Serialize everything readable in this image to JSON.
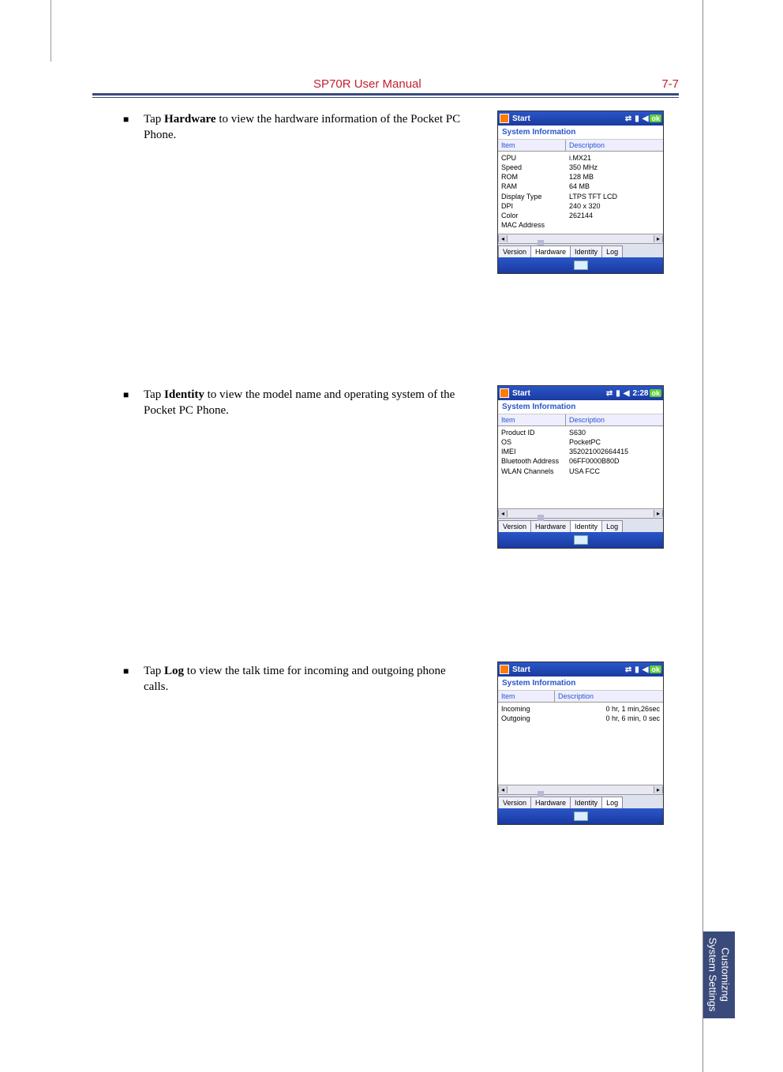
{
  "header": {
    "title": "SP70R User Manual",
    "page": "7-7"
  },
  "bullets": {
    "b1_pre": "Tap ",
    "b1_bold": "Hardware",
    "b1_post": " to view the hardware information of the Pocket PC Phone.",
    "b2_pre": "Tap ",
    "b2_bold": "Identity",
    "b2_post": " to view the model name and operating system of the Pocket PC Phone.",
    "b3_pre": "Tap ",
    "b3_bold": "Log",
    "b3_post": " to view the talk time for incoming and outgoing phone calls."
  },
  "wm_common": {
    "start": "Start",
    "ok": "ok",
    "subtitle": "System Information",
    "col_item": "Item",
    "col_desc": "Description",
    "tab_version": "Version",
    "tab_hardware": "Hardware",
    "tab_identity": "Identity",
    "tab_log": "Log"
  },
  "shot1": {
    "time": "",
    "items": [
      "CPU",
      "Speed",
      "ROM",
      "RAM",
      "Display Type",
      "DPI",
      "Color",
      "MAC Address"
    ],
    "descs": [
      "i.MX21",
      "350 MHz",
      "128 MB",
      "64 MB",
      "LTPS TFT LCD",
      "240 x 320",
      "262144",
      ""
    ],
    "active_tab": "Hardware"
  },
  "shot2": {
    "time": "2:28",
    "items": [
      "Product ID",
      "OS",
      "IMEI",
      "Bluetooth Address",
      "WLAN Channels"
    ],
    "descs": [
      "S630",
      "PocketPC",
      "352021002664415",
      "06FF0000B80D",
      "USA FCC"
    ],
    "active_tab": "Identity"
  },
  "shot3": {
    "time": "",
    "items": [
      "Incoming",
      "Outgoing"
    ],
    "descs": [
      "0 hr, 1 min,26sec",
      "0 hr, 6 min, 0 sec"
    ],
    "active_tab": "Log"
  },
  "side_tab": {
    "line1": "Customizng",
    "line2": "System Settings"
  }
}
